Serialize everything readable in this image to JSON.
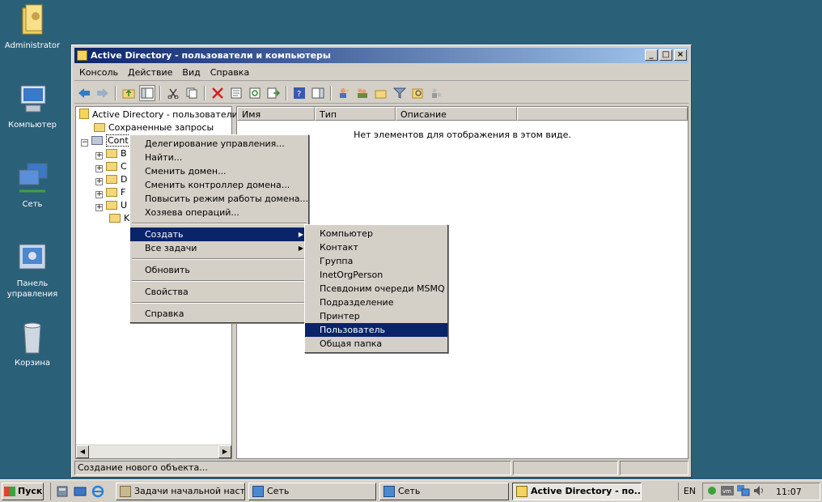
{
  "desktop": {
    "icons": [
      {
        "label": "Administrator"
      },
      {
        "label": "Компьютер"
      },
      {
        "label": "Сеть"
      },
      {
        "label": "Панель управления"
      },
      {
        "label": "Корзина"
      }
    ]
  },
  "window": {
    "title": "Active Directory - пользователи и компьютеры",
    "menu": [
      "Консоль",
      "Действие",
      "Вид",
      "Справка"
    ],
    "tree": {
      "root": "Active Directory - пользователи и",
      "saved_queries": "Сохраненные запросы",
      "domain": "Cont",
      "children": [
        "B",
        "C",
        "D",
        "F",
        "U",
        "K"
      ]
    },
    "columns": [
      "Имя",
      "Тип",
      "Описание"
    ],
    "empty_text": "Нет элементов для отображения в этом виде.",
    "status_text": "Создание нового объекта..."
  },
  "context_menu": {
    "items": [
      "Делегирование управления...",
      "Найти...",
      "Сменить домен...",
      "Сменить контроллер домена...",
      "Повысить режим работы домена...",
      "Хозяева операций...",
      "Создать",
      "Все задачи",
      "Обновить",
      "Свойства",
      "Справка"
    ],
    "selected": "Создать"
  },
  "submenu": {
    "items": [
      "Компьютер",
      "Контакт",
      "Группа",
      "InetOrgPerson",
      "Псевдоним очереди MSMQ",
      "Подразделение",
      "Принтер",
      "Пользователь",
      "Общая папка"
    ],
    "selected": "Пользователь"
  },
  "taskbar": {
    "start_label": "Пуск",
    "tasks": [
      {
        "label": "Задачи начальной наст..."
      },
      {
        "label": "Сеть"
      },
      {
        "label": "Сеть"
      },
      {
        "label": "Active Directory - по..."
      }
    ],
    "language": "EN",
    "clock": "11:07"
  },
  "colors": {
    "desktop": "#2b6079",
    "highlight": "#0a246a",
    "face": "#d4d0c8"
  }
}
